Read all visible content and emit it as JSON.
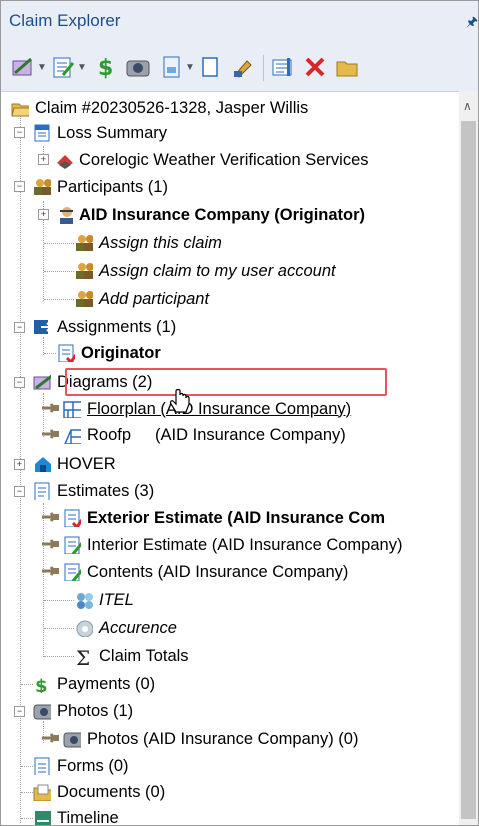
{
  "panel": {
    "title": "Claim Explorer",
    "pin_icon": "pin-icon"
  },
  "toolbar": {
    "buttons": [
      {
        "name": "diagram-tool-icon",
        "dropdown": true
      },
      {
        "name": "estimate-tool-icon",
        "dropdown": true
      },
      {
        "name": "payment-icon",
        "dropdown": false
      },
      {
        "name": "photo-icon",
        "dropdown": false
      },
      {
        "name": "document-icon",
        "dropdown": true
      },
      {
        "name": "new-page-icon",
        "dropdown": false
      },
      {
        "name": "edit-icon",
        "dropdown": false
      },
      {
        "name": "properties-icon",
        "dropdown": false
      },
      {
        "name": "delete-icon",
        "dropdown": false
      },
      {
        "name": "folder-icon",
        "dropdown": false
      }
    ]
  },
  "tree": {
    "root": "Claim #20230526-1328, Jasper Willis",
    "loss_summary": "Loss Summary",
    "weather": "Corelogic Weather Verification Services",
    "participants": "Participants (1)",
    "aid_originator": "AID Insurance Company (Originator)",
    "assign_claim": "Assign this claim",
    "assign_user": "Assign claim to my user account",
    "add_participant": "Add participant",
    "assignments": "Assignments (1)",
    "originator": "Originator",
    "diagrams": "Diagrams (2)",
    "floorplan": "Floorplan (AID Insurance Company)",
    "roofplan": "(AID Insurance Company)",
    "roofplan_prefix": "Roofp",
    "hover": "HOVER",
    "estimates": "Estimates (3)",
    "exterior": "Exterior Estimate (AID Insurance Com",
    "interior": "Interior Estimate (AID Insurance Company)",
    "contents": "Contents (AID Insurance Company)",
    "itel": "ITEL",
    "accurence": "Accurence",
    "claim_totals": "Claim Totals",
    "payments": "Payments (0)",
    "photos": "Photos (1)",
    "photos_aid": "Photos (AID Insurance Company) (0)",
    "forms": "Forms (0)",
    "documents": "Documents (0)",
    "timeline": "Timeline"
  },
  "colors": {
    "highlight_border": "#e8555a",
    "title_bg": "#e9eef6",
    "title_text": "#1a4f8c"
  }
}
